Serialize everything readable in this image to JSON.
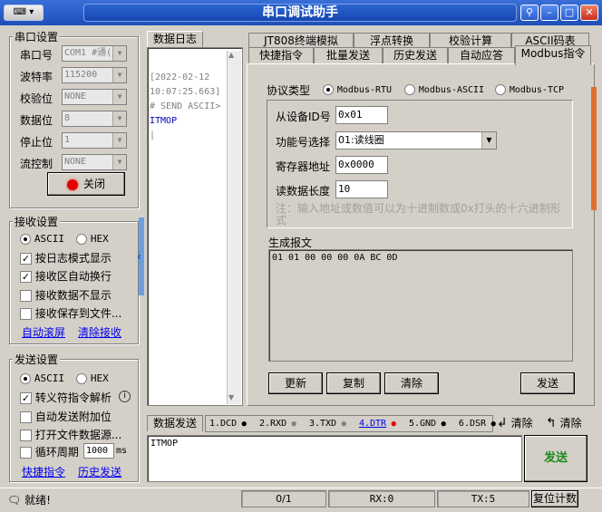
{
  "window": {
    "title": "串口调试助手",
    "menu_icon": "keyboard-icon",
    "pin_icon": "pin-icon"
  },
  "serial": {
    "group_label": "串口设置",
    "port_label": "串口号",
    "port_value": "COM1 #通(",
    "baud_label": "波特率",
    "baud_value": "115200",
    "parity_label": "校验位",
    "parity_value": "NONE",
    "databits_label": "数据位",
    "databits_value": "8",
    "stopbits_label": "停止位",
    "stopbits_value": "1",
    "flow_label": "流控制",
    "flow_value": "NONE",
    "close_button": "关闭",
    "status_color": "#e00000"
  },
  "receive": {
    "group_label": "接收设置",
    "ascii": "ASCII",
    "hex": "HEX",
    "log_mode": "按日志模式显示",
    "auto_wrap": "接收区自动换行",
    "hide_data": "接收数据不显示",
    "save_file": "接收保存到文件...",
    "auto_scroll": "自动滚屏",
    "clear_recv": "清除接收"
  },
  "send": {
    "group_label": "发送设置",
    "ascii": "ASCII",
    "hex": "HEX",
    "escape": "转义符指令解析",
    "info_icon": "i",
    "append": "自动发送附加位",
    "open_file": "打开文件数据源...",
    "cycle_label": "循环周期",
    "cycle_value": "1000",
    "cycle_unit": "ms",
    "quick_cmd": "快捷指令",
    "history": "历史发送"
  },
  "log": {
    "tab": "数据日志",
    "lines": [
      "[2022-02-12",
      "10:07:25.663]",
      "# SEND ASCII>"
    ],
    "sent_text": "ITMOP"
  },
  "tabs": {
    "row1": [
      "JT808终端模拟",
      "浮点转换",
      "校验计算",
      "ASCII码表"
    ],
    "row2": [
      "快捷指令",
      "批量发送",
      "历史发送",
      "自动应答",
      "Modbus指令"
    ]
  },
  "modbus": {
    "protocol_label": "协议类型",
    "protocols": [
      "Modbus-RTU",
      "Modbus-ASCII",
      "Modbus-TCP"
    ],
    "slave_label": "从设备ID号",
    "slave_value": "0x01",
    "func_label": "功能号选择",
    "func_value": "01:读线圈",
    "reg_label": "寄存器地址",
    "reg_value": "0x0000",
    "len_label": "读数据长度",
    "len_value": "10",
    "note": "注：输入地址或数值可以为十进制数或0x打头的十六进制形式",
    "gen_label": "生成报文",
    "gen_value": "01 01 00 00 00 0A BC 0D",
    "btn_update": "更新",
    "btn_copy": "复制",
    "btn_clear": "清除",
    "btn_send": "发送"
  },
  "sendbar": {
    "tab": "数据发送",
    "pins": [
      "1.DCD",
      "2.RXD",
      "3.TXD",
      "4.DTR",
      "5.GND",
      "6.DSR"
    ],
    "clear1": "清除",
    "clear2": "清除",
    "text": "ITMOP",
    "send_button": "发送"
  },
  "status": {
    "ready": "就绪!",
    "progress": "0/1",
    "rx": "RX:0",
    "tx": "TX:5",
    "reset": "复位计数"
  }
}
